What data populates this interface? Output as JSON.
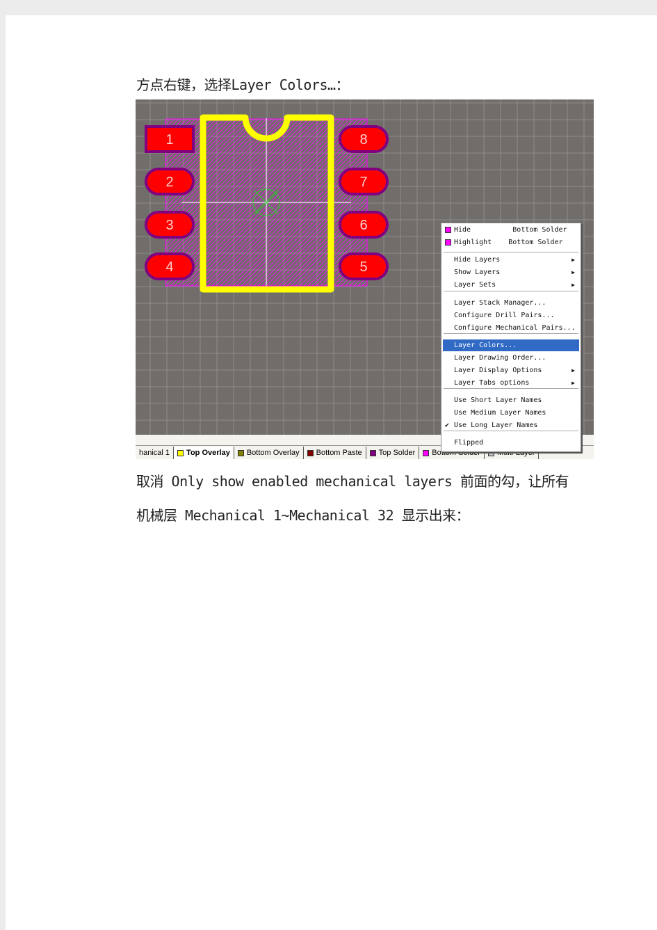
{
  "text": {
    "line1": "方点右键，选择Layer Colors…：",
    "line2": "取消 Only show enabled mechanical layers 前面的勾，让所有",
    "line3": "机械层 Mechanical 1~Mechanical 32 显示出来："
  },
  "pcb": {
    "pads": [
      "1",
      "2",
      "3",
      "4",
      "8",
      "7",
      "6",
      "5"
    ],
    "colors": {
      "background": "#716d6b",
      "pad": "#ff0000",
      "pad_border": "#800080",
      "overlay": "#ffff00",
      "hatch": "#ff00ff"
    }
  },
  "tabs": [
    {
      "label": "hanical 1",
      "color": null
    },
    {
      "label": "Top Overlay",
      "color": "#ffff00",
      "active": true
    },
    {
      "label": "Bottom Overlay",
      "color": "#808000"
    },
    {
      "label": "Bottom Paste",
      "color": "#800000"
    },
    {
      "label": "Top Solder",
      "color": "#800080"
    },
    {
      "label": "Bottom Solder",
      "color": "#ff00ff"
    },
    {
      "label": "Multi-Layer",
      "color": "#c0c0c0"
    }
  ],
  "menu": {
    "hide": "Hide          Bottom Solder",
    "highlight": "Highlight    Bottom Solder",
    "items": [
      "Hide Layers",
      "Show Layers",
      "Layer Sets",
      "Layer Stack Manager...",
      "Configure Drill Pairs...",
      "Configure Mechanical Pairs...",
      "Layer Colors...",
      "Layer Drawing Order...",
      "Layer Display Options",
      "Layer Tabs options",
      "Use Short Layer Names",
      "Use Medium Layer Names",
      "Use Long Layer Names",
      "Flipped"
    ],
    "checked": "Use Long Layer Names",
    "highlighted": "Layer Colors..."
  }
}
